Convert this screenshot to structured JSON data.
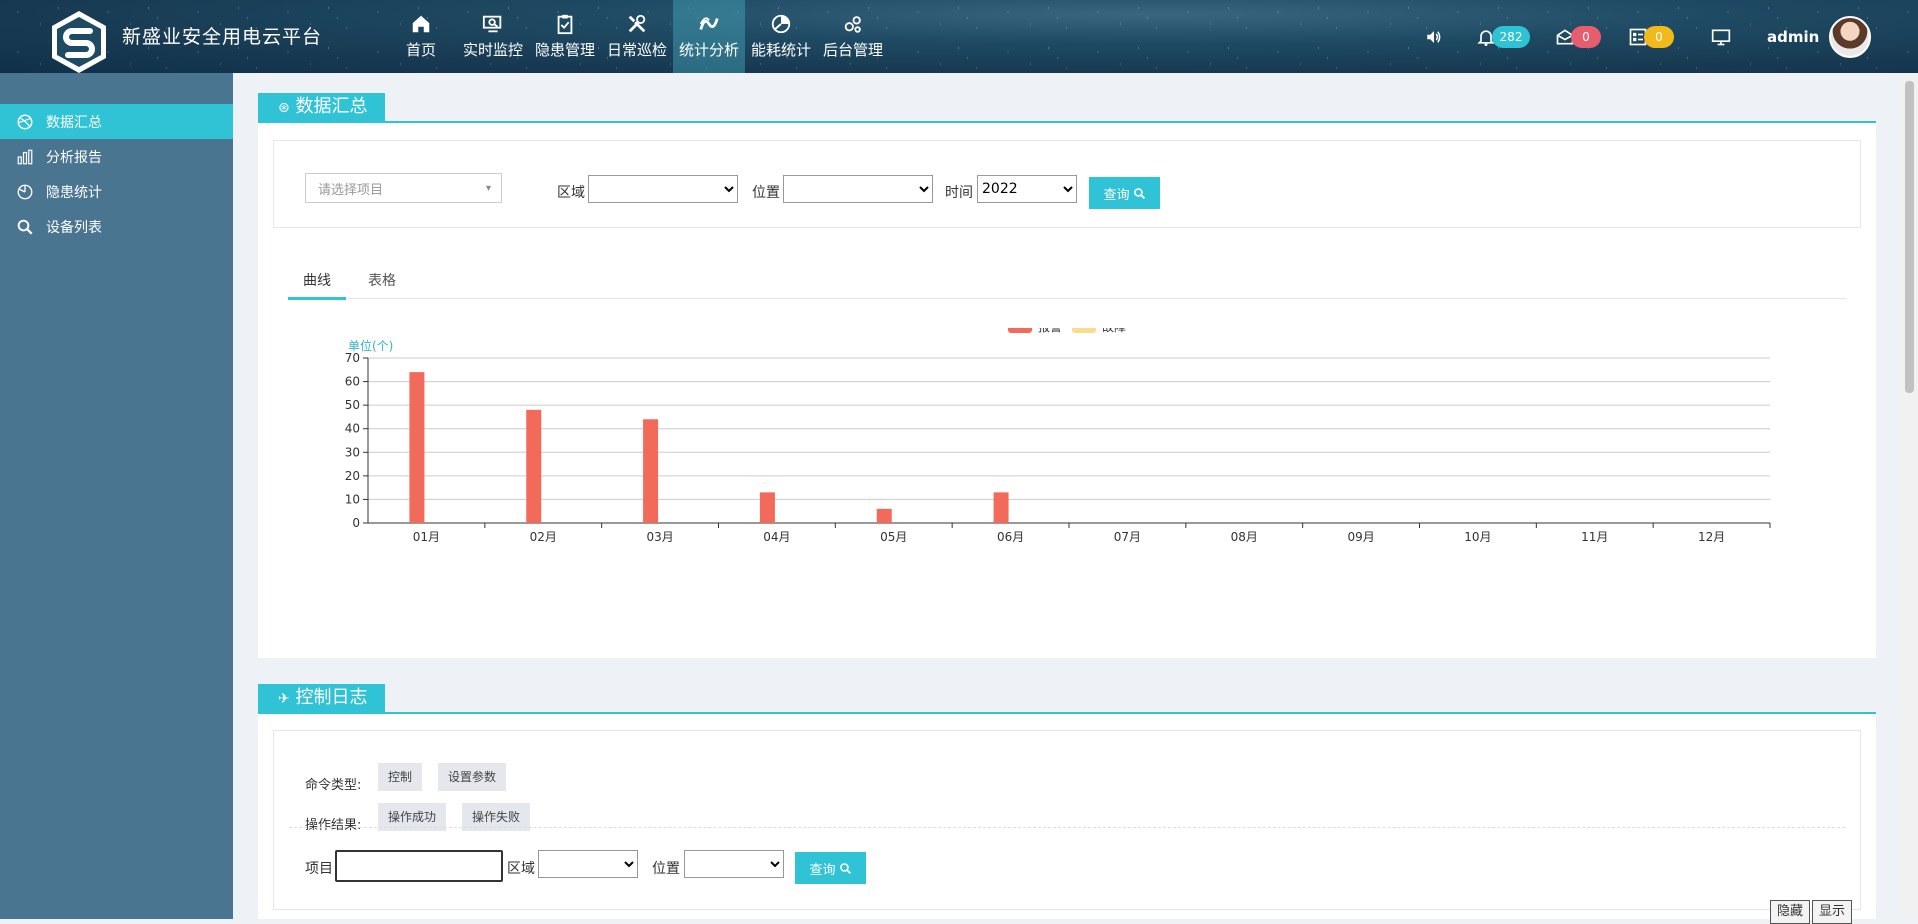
{
  "header": {
    "brand": "新盛业安全用电云平台",
    "nav": [
      {
        "label": "首页",
        "icon": "home-icon"
      },
      {
        "label": "实时监控",
        "icon": "monitor-search-icon"
      },
      {
        "label": "隐患管理",
        "icon": "clipboard-check-icon"
      },
      {
        "label": "日常巡检",
        "icon": "tools-icon"
      },
      {
        "label": "统计分析",
        "icon": "wave-icon",
        "active": true
      },
      {
        "label": "能耗统计",
        "icon": "pie-icon"
      },
      {
        "label": "后台管理",
        "icon": "gears-icon"
      }
    ],
    "alarm_count": "282",
    "mail_count": "0",
    "task_count": "0",
    "username": "admin"
  },
  "sidebar": {
    "items": [
      {
        "label": "数据汇总",
        "active": true
      },
      {
        "label": "分析报告"
      },
      {
        "label": "隐患统计"
      },
      {
        "label": "设备列表"
      }
    ]
  },
  "summary": {
    "title": "数据汇总",
    "project_placeholder": "请选择项目",
    "area_label": "区域",
    "position_label": "位置",
    "time_label": "时间",
    "time_value": "2022",
    "query_label": "查询",
    "tabs": [
      "曲线",
      "表格"
    ]
  },
  "chart_data": {
    "type": "bar",
    "unit_label": "单位(个)",
    "categories": [
      "01月",
      "02月",
      "03月",
      "04月",
      "05月",
      "06月",
      "07月",
      "08月",
      "09月",
      "10月",
      "11月",
      "12月"
    ],
    "series": [
      {
        "name": "报警",
        "color": "#f26a5a",
        "values": [
          64,
          48,
          44,
          13,
          6,
          13,
          0,
          0,
          0,
          0,
          0,
          0
        ]
      },
      {
        "name": "故障",
        "color": "#f8dd8e",
        "values": [
          0,
          0,
          0,
          0,
          0,
          0,
          0,
          0,
          0,
          0,
          0,
          0
        ]
      }
    ],
    "ylim": [
      0,
      70
    ],
    "yticks": [
      0,
      10,
      20,
      30,
      40,
      50,
      60,
      70
    ],
    "legend": "top-center",
    "grid": true
  },
  "log": {
    "title": "控制日志",
    "cmd_type_label": "命令类型:",
    "cmd_types": [
      "控制",
      "设置参数"
    ],
    "result_label": "操作结果:",
    "results": [
      "操作成功",
      "操作失败"
    ],
    "project_label": "项目",
    "area_label": "区域",
    "position_label": "位置",
    "query_label": "查询",
    "hide_label": "隐藏",
    "show_label": "显示"
  }
}
